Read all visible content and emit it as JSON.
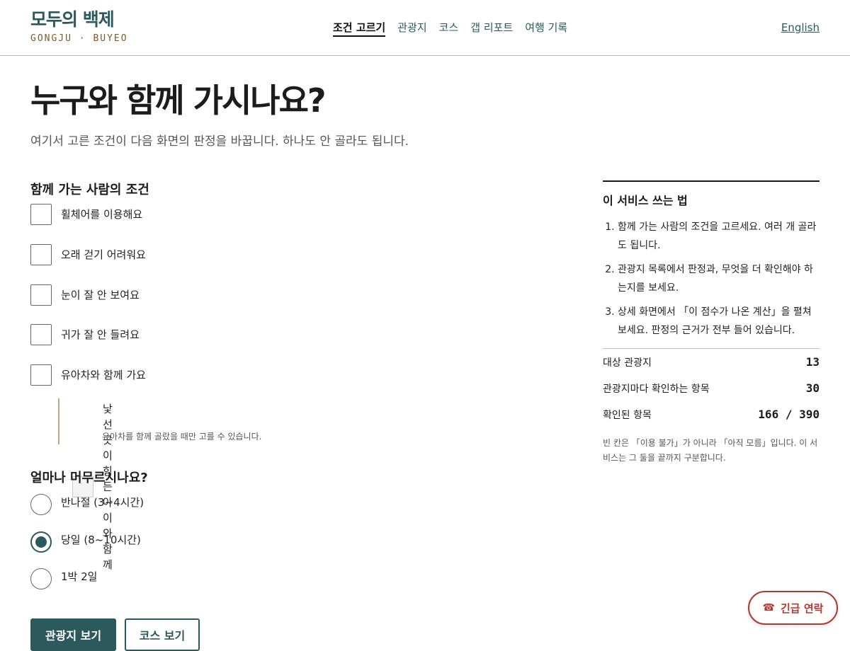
{
  "header": {
    "brand_name": "모두의 백제",
    "brand_sub": "GONGJU · BUYEO",
    "nav": [
      "조건 고르기",
      "관광지",
      "코스",
      "갭 리포트",
      "여행 기록"
    ],
    "active_nav": "조건 고르기",
    "lang": "English"
  },
  "main": {
    "title": "누구와 함께 가시나요?",
    "subtitle": "여기서 고른 조건이 다음 화면의 판정을 바꿉니다. 하나도 안 골라도 됩니다.",
    "companions": {
      "title": "함께 가는 사람의 조건",
      "options": [
        {
          "label": "휠체어를 이용해요",
          "checked": false
        },
        {
          "label": "오래 걷기 어려워요",
          "checked": false
        },
        {
          "label": "눈이 잘 안 보여요",
          "checked": false
        },
        {
          "label": "귀가 잘 안 들려요",
          "checked": false
        },
        {
          "label": "유아차와 함께 가요",
          "checked": false
        }
      ],
      "sub_option": {
        "label": "낯선 곳이 힘든 아이와 함께",
        "hint": "유아차를 함께 골랐을 때만 고를 수 있습니다.",
        "disabled": true
      }
    },
    "duration": {
      "title": "얼마나 머무르시나요?",
      "options": [
        "반나절 (3~4시간)",
        "당일 (8~10시간)",
        "1박 2일"
      ],
      "selected": "당일 (8~10시간)"
    },
    "buttons": {
      "primary": "관광지 보기",
      "secondary": "코스 보기"
    }
  },
  "aside": {
    "title": "이 서비스 쓰는 법",
    "steps": [
      "함께 가는 사람의 조건을 고르세요. 여러 개 골라도 됩니다.",
      "관광지 목록에서 판정과, 무엇을 더 확인해야 하는지를 보세요.",
      "상세 화면에서 「이 점수가 나온 계산」을 펼쳐 보세요. 판정의 근거가 전부 들어 있습니다."
    ],
    "stats": [
      {
        "label": "대상 관광지",
        "value": "13"
      },
      {
        "label": "관광지마다 확인하는 항목",
        "value": "30"
      },
      {
        "label": "확인된 항목",
        "value": "166 / 390"
      }
    ],
    "note": "빈 칸은 「이용 불가」가 아니라 「아직 모름」입니다. 이 서비스는 그 둘을 끝까지 구분합니다."
  },
  "emergency": {
    "icon": "phone-icon",
    "label": "긴급 연락"
  },
  "colors": {
    "brand": "#2c5a5c",
    "accent_gold": "#7a5c2e",
    "emergency": "#b03a32"
  }
}
